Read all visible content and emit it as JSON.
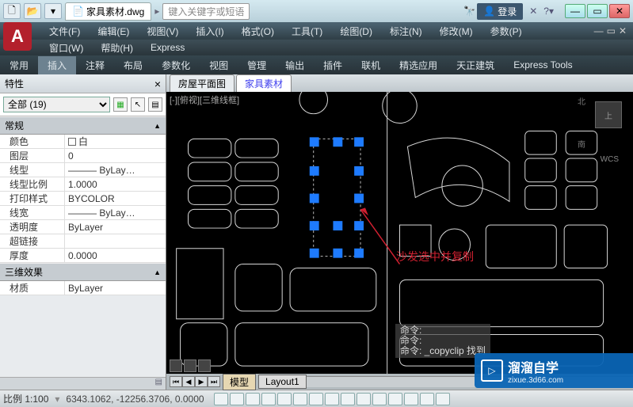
{
  "titlebar": {
    "filename": "家具素材.dwg",
    "search_placeholder": "键入关键字或短语",
    "login": "登录"
  },
  "menus1": [
    "文件(F)",
    "编辑(E)",
    "视图(V)",
    "插入(I)",
    "格式(O)",
    "工具(T)",
    "绘图(D)",
    "标注(N)",
    "修改(M)",
    "参数(P)"
  ],
  "menus2": [
    "窗口(W)",
    "帮助(H)",
    "Express"
  ],
  "ribbon": [
    "常用",
    "插入",
    "注释",
    "布局",
    "参数化",
    "视图",
    "管理",
    "输出",
    "插件",
    "联机",
    "精选应用",
    "天正建筑",
    "Express Tools"
  ],
  "ribbon_active": "插入",
  "doc_tabs": [
    "房屋平面图",
    "家具素材"
  ],
  "doc_tab_active": "家具素材",
  "properties": {
    "title": "特性",
    "filter": "全部 (19)",
    "sections": {
      "general": "常规",
      "threeD": "三维效果"
    },
    "rows": {
      "color_k": "颜色",
      "color_v": "白",
      "layer_k": "图层",
      "layer_v": "0",
      "ltype_k": "线型",
      "ltype_v": "——— ByLay…",
      "ltscale_k": "线型比例",
      "ltscale_v": "1.0000",
      "pstyle_k": "打印样式",
      "pstyle_v": "BYCOLOR",
      "lweight_k": "线宽",
      "lweight_v": "——— ByLay…",
      "trans_k": "透明度",
      "trans_v": "ByLayer",
      "hyper_k": "超链接",
      "hyper_v": "",
      "thick_k": "厚度",
      "thick_v": "0.0000",
      "mat_k": "材质",
      "mat_v": "ByLayer"
    }
  },
  "viewport": {
    "label": "[-][俯视][三维线框]",
    "annotation": "沙发选中并复制",
    "navcube": "上",
    "wcs": "WCS",
    "compass_n": "北",
    "compass_s": "南",
    "cmd1": "命令:",
    "cmd2": "命令:",
    "cmd3": "命令: _copyclip 找到"
  },
  "layout_tabs": [
    "模型",
    "Layout1"
  ],
  "statusbar": {
    "scale": "比例 1:100",
    "coords": "6343.1062, -12256.3706, 0.0000"
  },
  "watermark": {
    "brand": "溜溜自学",
    "site": "zixue.3d66.com"
  }
}
